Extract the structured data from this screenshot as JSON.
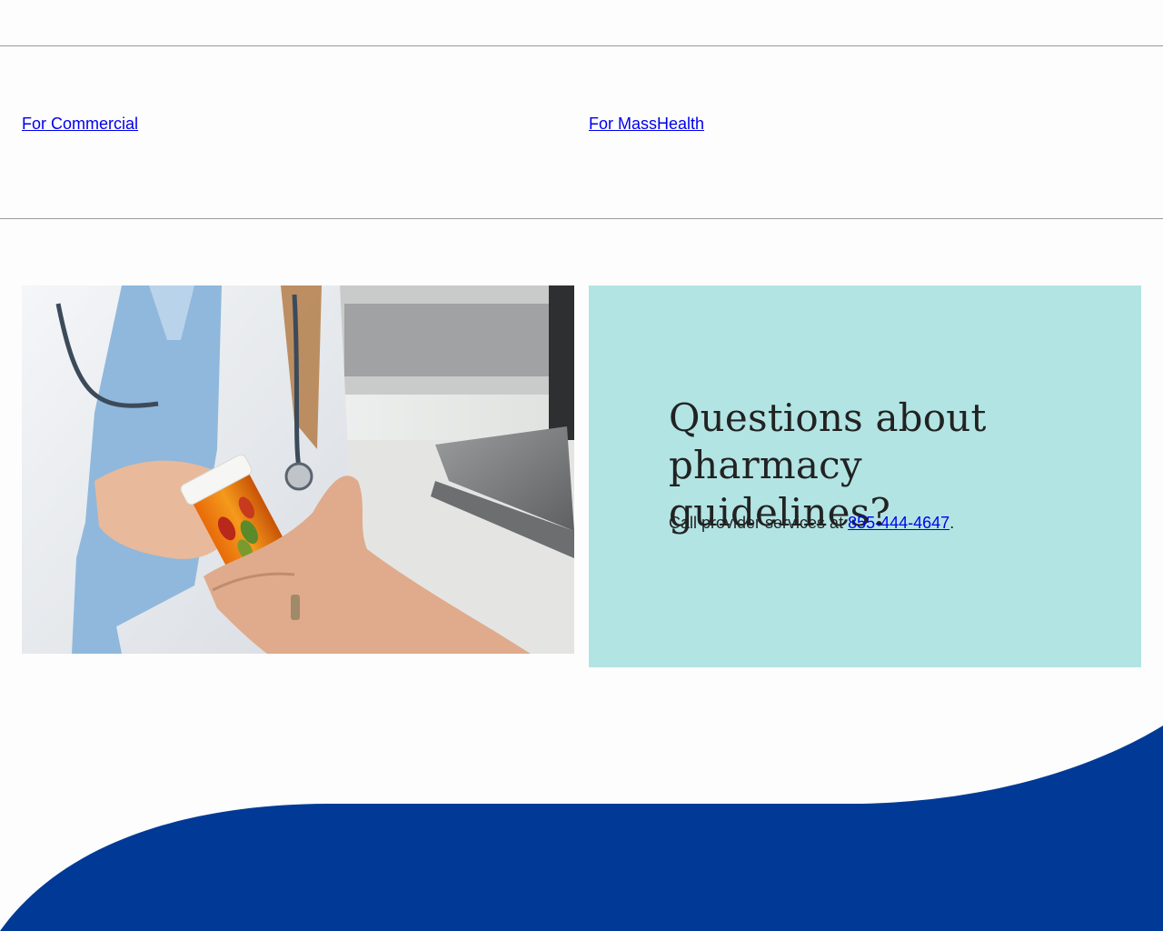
{
  "links": {
    "commercial": "For Commercial",
    "masshealth": "For MassHealth"
  },
  "photo": {
    "description_icon": "pharmacist-handing-prescription-bottle-image"
  },
  "info_panel": {
    "heading": "Questions about pharmacy guidelines?",
    "body_prefix": "Call provider services at ",
    "phone": "855-444-4647",
    "body_suffix": "."
  },
  "colors": {
    "link": "#0000ee",
    "panel_bg": "#b2e4e3",
    "footer_blue": "#003a96",
    "divider": "#9a9a9a"
  }
}
